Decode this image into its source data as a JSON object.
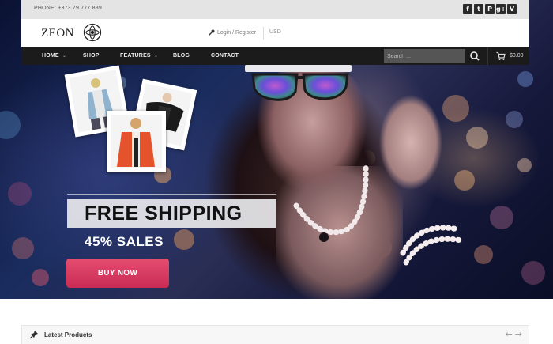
{
  "topbar": {
    "phone": "PHONE: +373 79 777 889"
  },
  "social": [
    {
      "icon": "facebook-icon",
      "glyph": "f"
    },
    {
      "icon": "tumblr-icon",
      "glyph": "t"
    },
    {
      "icon": "pinterest-icon",
      "glyph": "P"
    },
    {
      "icon": "google-plus-icon",
      "glyph": "g+"
    },
    {
      "icon": "vimeo-icon",
      "glyph": "V"
    }
  ],
  "header": {
    "logo": "ZEON",
    "login": "Login / Register",
    "currency": "USD"
  },
  "nav": {
    "items": [
      "HOME",
      "SHOP",
      "FEATURES",
      "BLOG",
      "CONTACT"
    ],
    "search_placeholder": "Search ...",
    "cart_total": "$0.00"
  },
  "hero": {
    "headline": "FREE SHIPPING",
    "subline": "45% SALES",
    "button": "BUY NOW"
  },
  "latest": {
    "title": "Latest Products",
    "prev": "←",
    "next": "→"
  },
  "colors": {
    "accent": "#d83a62",
    "nav_bg": "#1b1b1b",
    "topbar_bg": "#e4e4e4"
  }
}
